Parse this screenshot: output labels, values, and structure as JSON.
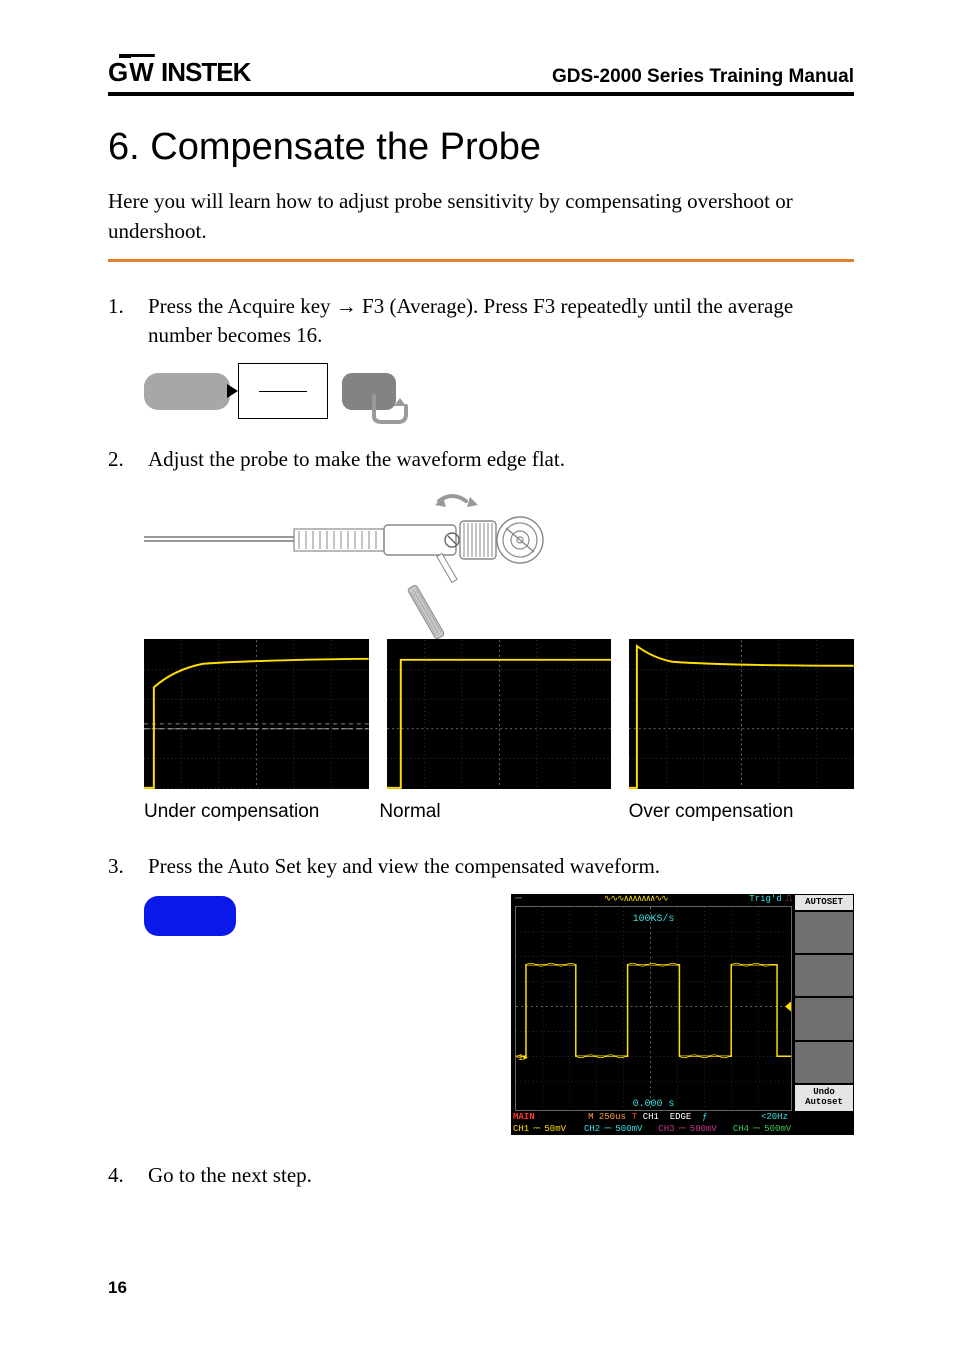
{
  "header": {
    "brand": "GWINSTEK",
    "doc_title": "GDS-2000 Series Training Manual"
  },
  "section": {
    "number": "6.",
    "title": "Compensate the Probe",
    "intro": "Here you will learn how to adjust probe sensitivity by compensating overshoot or undershoot."
  },
  "steps": {
    "s1": "Press the Acquire key → F3 (Average). Press F3 repeatedly until the average number becomes 16.",
    "s2": "Adjust the probe to make the waveform edge flat.",
    "s3": "Press the Auto Set key and view the compensated waveform.",
    "s4": "Go to the next step."
  },
  "captions": {
    "under": "Under compensation",
    "normal": "Normal",
    "over": "Over compensation"
  },
  "oscope": {
    "autoset": "AUTOSET",
    "undo": "Undo Autoset",
    "trigd": "Trig'd",
    "sample": "100KS/s",
    "time_pos": "0.000 s",
    "main": "MAIN",
    "m_time": "M 250us",
    "tch": "T CH1",
    "edge": "EDGE",
    "freq": "<20Hz",
    "ch1": "CH1",
    "ch1v": "50mV",
    "ch2": "CH2",
    "ch2v": "500mV",
    "ch3": "CH3",
    "ch3v": "500mV",
    "ch4": "CH4",
    "ch4v": "500mV"
  },
  "page_number": "16"
}
